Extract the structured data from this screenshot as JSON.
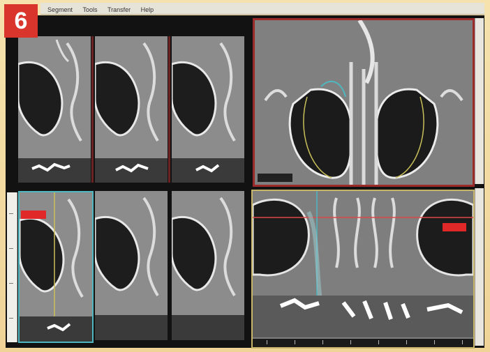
{
  "badge": {
    "number": "6",
    "color": "#d9352d"
  },
  "menu": {
    "items": [
      "Segment",
      "Tools",
      "Transfer",
      "Help"
    ]
  },
  "panels": {
    "sagittal_top": [
      "sagittal-slice-1",
      "sagittal-slice-2",
      "sagittal-slice-3"
    ],
    "sagittal_bottom": [
      "sagittal-slice-4",
      "sagittal-slice-5",
      "sagittal-slice-6"
    ],
    "axial": "axial-view",
    "coronal": "coronal-view"
  },
  "colors": {
    "axial_border": "#9b2a2a",
    "coronal_border": "#c8b56a",
    "selected_slice_border": "#4fb7c0",
    "marker": "#e02828",
    "reference_line": "#d94a4a"
  }
}
